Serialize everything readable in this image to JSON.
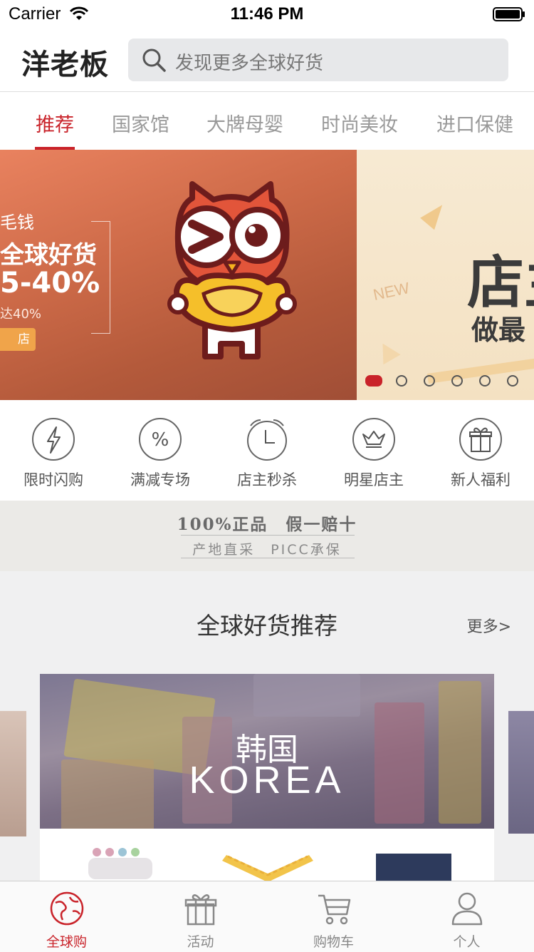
{
  "status_bar": {
    "carrier": "Carrier",
    "time": "11:46 PM"
  },
  "header": {
    "logo": "洋老板",
    "search_placeholder": "发现更多全球好货"
  },
  "tabs": [
    {
      "label": "推荐",
      "active": true
    },
    {
      "label": "国家馆"
    },
    {
      "label": "大牌母婴"
    },
    {
      "label": "时尚美妆"
    },
    {
      "label": "进口保健"
    }
  ],
  "banner": {
    "slide1": {
      "line1": "毛钱",
      "line2": "全球好货",
      "line3": "5-40%",
      "line4": "达40%",
      "button": "店"
    },
    "slide2": {
      "tag": "NEW",
      "big": "店主",
      "small": "做最"
    },
    "page_count": 6,
    "active_index": 0
  },
  "quick_links": [
    {
      "label": "限时闪购",
      "icon": "lightning-icon"
    },
    {
      "label": "满减专场",
      "icon": "percent-icon"
    },
    {
      "label": "店主秒杀",
      "icon": "alarm-clock-icon"
    },
    {
      "label": "明星店主",
      "icon": "crown-icon"
    },
    {
      "label": "新人福利",
      "icon": "gift-icon"
    }
  ],
  "guarantee": {
    "top": "100%正品　假一赔十",
    "bottom": "产地直采　PICC承保"
  },
  "section": {
    "title": "全球好货推荐",
    "more": "更多>",
    "card": {
      "country_cn": "韩国",
      "country_en": "KOREA"
    }
  },
  "tabbar": [
    {
      "label": "全球购",
      "icon": "globe-icon",
      "active": true
    },
    {
      "label": "活动",
      "icon": "gift-icon"
    },
    {
      "label": "购物车",
      "icon": "cart-icon"
    },
    {
      "label": "个人",
      "icon": "person-icon"
    }
  ],
  "colors": {
    "accent": "#c9232a",
    "search_bg": "#e7e8ea"
  }
}
